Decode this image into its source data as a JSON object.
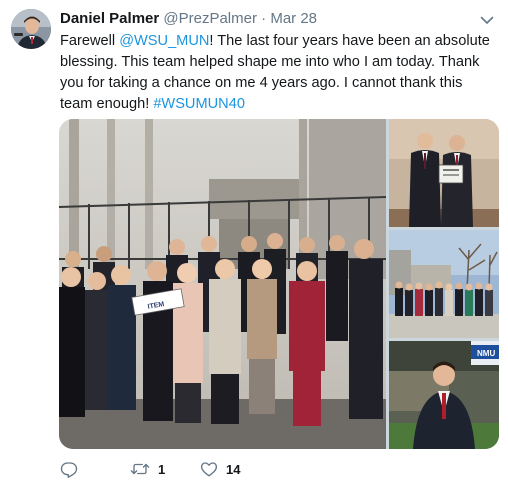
{
  "author": {
    "name": "Daniel Palmer",
    "handle": "@PrezPalmer",
    "separator": "·",
    "date": "Mar 28"
  },
  "tweet": {
    "part1": "Farewell ",
    "mention": "@WSU_MUN",
    "part2": "! The last four years have been an absolute blessing. This team helped shape me into who I am today. Thank you for taking a chance on me 4 years ago. I cannot thank this team enough! ",
    "hashtag": "#WSUMUN40"
  },
  "media": {
    "photos": [
      {
        "id": "main",
        "sign_text": "ITEM"
      },
      {
        "id": "top-right"
      },
      {
        "id": "middle-right"
      },
      {
        "id": "bottom-right",
        "sign_text": "NMU"
      }
    ]
  },
  "actions": {
    "reply_icon": "reply-icon",
    "retweet_icon": "retweet-icon",
    "like_icon": "heart-icon",
    "retweet_count": "1",
    "like_count": "14"
  },
  "colors": {
    "link": "#1b95e0",
    "secondary_text": "#657786",
    "primary_text": "#14171a"
  }
}
